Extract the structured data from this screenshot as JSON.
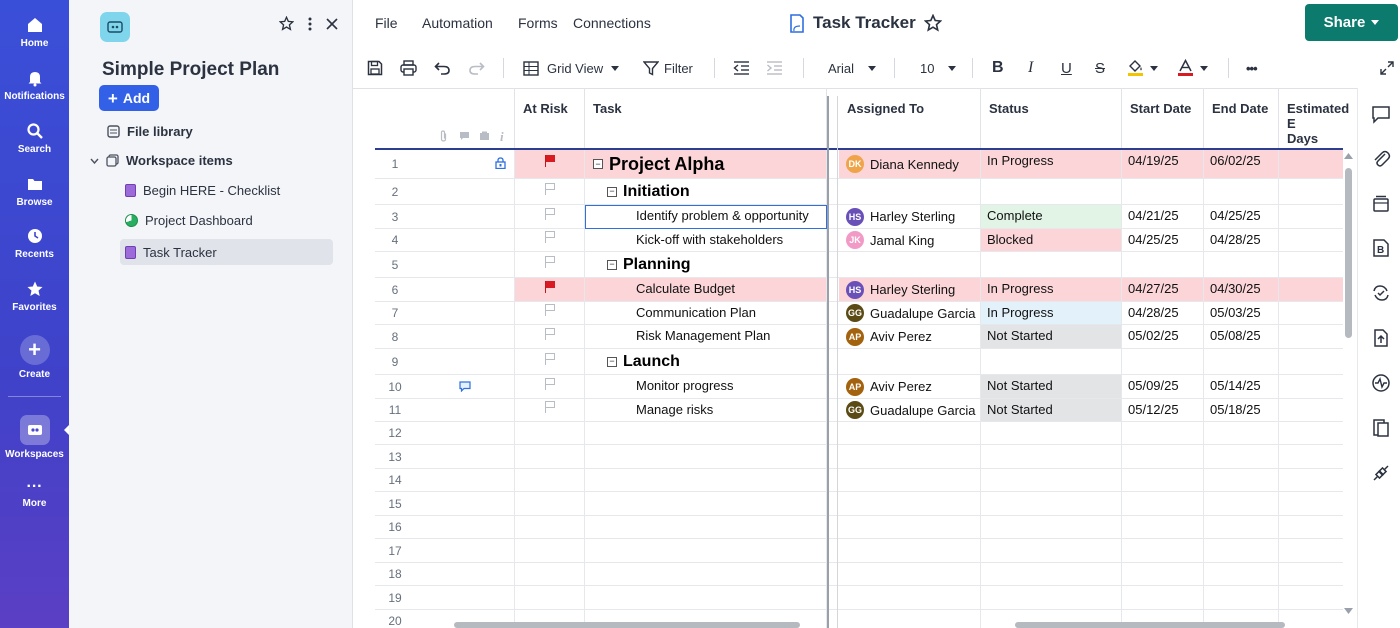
{
  "rail": {
    "items": [
      {
        "label": "Home",
        "icon": "home-icon"
      },
      {
        "label": "Notifications",
        "icon": "bell-icon"
      },
      {
        "label": "Search",
        "icon": "search-icon"
      },
      {
        "label": "Browse",
        "icon": "folder-icon"
      },
      {
        "label": "Recents",
        "icon": "clock-icon"
      },
      {
        "label": "Favorites",
        "icon": "star-icon"
      }
    ],
    "create_label": "Create",
    "workspaces_label": "Workspaces",
    "more_label": "More",
    "more_glyph": "···"
  },
  "sidebar": {
    "title": "Simple Project Plan",
    "add_label": "Add",
    "file_library": "File library",
    "workspace_items": "Workspace items",
    "items": [
      {
        "label": "Begin HERE - Checklist",
        "icon": "sheet-icon"
      },
      {
        "label": "Project Dashboard",
        "icon": "dashboard-icon"
      },
      {
        "label": "Task Tracker",
        "icon": "sheet-icon",
        "active": true
      }
    ]
  },
  "header": {
    "menus": [
      "File",
      "Automation",
      "Forms",
      "Connections"
    ],
    "doc_title": "Task Tracker",
    "share_label": "Share"
  },
  "toolbar": {
    "view_label": "Grid View",
    "filter_label": "Filter",
    "font": "Arial",
    "font_size": "10",
    "bold": "B",
    "italic": "I",
    "underline": "U",
    "strike": "S",
    "more": "•••"
  },
  "grid": {
    "columns": [
      "At Risk",
      "Task",
      "Assigned To",
      "Status",
      "Start Date",
      "End Date",
      "Estimated Days"
    ],
    "estimated_line1": "Estimated E",
    "estimated_line2": "Days",
    "rows": [
      {
        "num": "1",
        "risk": true,
        "task": "Project Alpha",
        "level": 0,
        "assigned": "Diana Kennedy",
        "initials": "DK",
        "status": "In Progress",
        "start": "04/19/25",
        "end": "06/02/25",
        "highlight": true,
        "lock": true
      },
      {
        "num": "2",
        "risk": false,
        "task": "Initiation",
        "level": 1
      },
      {
        "num": "3",
        "risk": false,
        "task": "Identify problem & opportunity",
        "level": 2,
        "assigned": "Harley Sterling",
        "initials": "HS",
        "status": "Complete",
        "start": "04/21/25",
        "end": "04/25/25",
        "selected": true
      },
      {
        "num": "4",
        "risk": false,
        "task": "Kick-off with stakeholders",
        "level": 2,
        "assigned": "Jamal King",
        "initials": "JK",
        "status": "Blocked",
        "start": "04/25/25",
        "end": "04/28/25"
      },
      {
        "num": "5",
        "risk": false,
        "task": "Planning",
        "level": 1
      },
      {
        "num": "6",
        "risk": true,
        "task": "Calculate Budget",
        "level": 2,
        "assigned": "Harley Sterling",
        "initials": "HS",
        "status": "In Progress",
        "start": "04/27/25",
        "end": "04/30/25",
        "highlight": true
      },
      {
        "num": "7",
        "risk": false,
        "task": "Communication Plan",
        "level": 2,
        "assigned": "Guadalupe Garcia",
        "initials": "GG",
        "status": "In Progress",
        "start": "04/28/25",
        "end": "05/03/25"
      },
      {
        "num": "8",
        "risk": false,
        "task": "Risk Management Plan",
        "level": 2,
        "assigned": "Aviv Perez",
        "initials": "AP",
        "status": "Not Started",
        "start": "05/02/25",
        "end": "05/08/25"
      },
      {
        "num": "9",
        "risk": false,
        "task": "Launch",
        "level": 1
      },
      {
        "num": "10",
        "risk": false,
        "task": "Monitor progress",
        "level": 2,
        "assigned": "Aviv Perez",
        "initials": "AP",
        "status": "Not Started",
        "start": "05/09/25",
        "end": "05/14/25",
        "comment": true
      },
      {
        "num": "11",
        "risk": false,
        "task": "Manage risks",
        "level": 2,
        "assigned": "Guadalupe Garcia",
        "initials": "GG",
        "status": "Not Started",
        "start": "05/12/25",
        "end": "05/18/25"
      },
      {
        "num": "12"
      },
      {
        "num": "13"
      },
      {
        "num": "14"
      },
      {
        "num": "15"
      },
      {
        "num": "16"
      },
      {
        "num": "17"
      },
      {
        "num": "18"
      },
      {
        "num": "19"
      },
      {
        "num": "20"
      }
    ]
  },
  "colors": {
    "highlight_row": "#fbd5d8",
    "status_complete": "#e2f4e5",
    "status_blocked": "#fbd5d8",
    "status_in_progress": "#e3f1fb",
    "status_not_started": "#e3e4e6",
    "DK": "#f0a44a",
    "HS": "#6950b8",
    "JK": "#f29ac6",
    "GG": "#5a4a14",
    "AP": "#a3620d"
  }
}
